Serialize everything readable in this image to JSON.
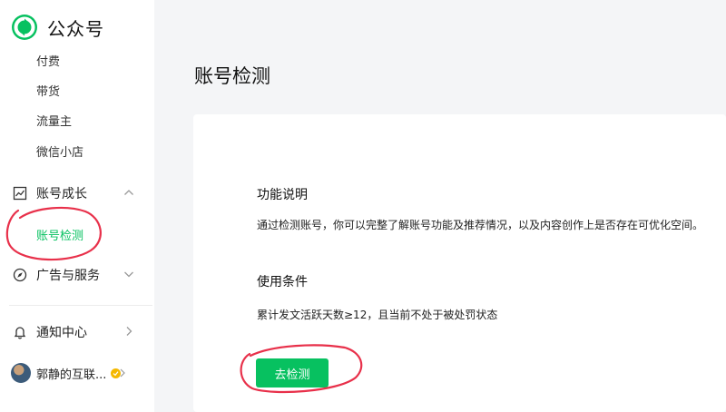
{
  "app": {
    "logo_text": "公众号"
  },
  "sidebar": {
    "sub_items": [
      {
        "label": "付费"
      },
      {
        "label": "带货"
      },
      {
        "label": "流量主"
      },
      {
        "label": "微信小店"
      }
    ],
    "groups": [
      {
        "label": "账号成长",
        "expanded": true
      },
      {
        "label": "广告与服务",
        "expanded": false
      }
    ],
    "active_item": {
      "label": "账号检测"
    },
    "notification": {
      "label": "通知中心"
    },
    "user": {
      "name": "郭静的互联..."
    }
  },
  "main": {
    "title": "账号检测",
    "sections": [
      {
        "title": "功能说明",
        "desc": "通过检测账号，你可以完整了解账号功能及推荐情况，以及内容创作上是否存在可优化空间。"
      },
      {
        "title": "使用条件",
        "desc": "累计发文活跃天数≥12，且当前不处于被处罚状态"
      }
    ],
    "action_button": "去检测"
  },
  "colors": {
    "accent": "#07c160",
    "annotation": "#e8304a",
    "page_bg": "#f4f5f7"
  }
}
